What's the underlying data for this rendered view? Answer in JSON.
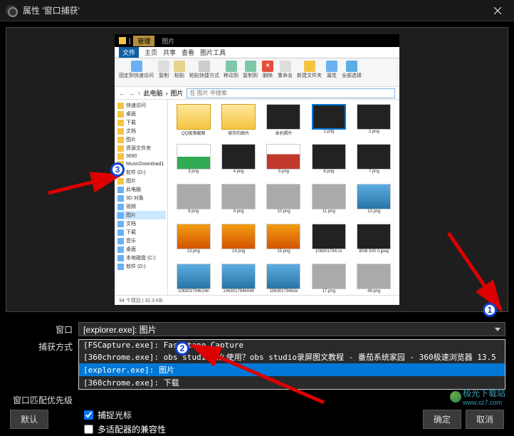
{
  "titlebar": {
    "title": "属性 '窗口捕获'"
  },
  "explorer": {
    "tab_main": "管理",
    "tab_sub": "图片",
    "ribbon": {
      "file": "文件",
      "home": "主页",
      "share": "共享",
      "view": "查看",
      "pictools": "图片工具"
    },
    "tools": {
      "nav": "固定到快速访问",
      "copy": "复制",
      "paste": "粘贴",
      "shortcut": "粘贴快捷方式",
      "move": "移动到",
      "copy_to": "复制到",
      "delete": "删除",
      "rename": "重命名",
      "new": "新建文件夹",
      "props": "属性",
      "select": "全部选择"
    },
    "path": {
      "seg1": "此电脑",
      "seg2": "图片",
      "search": "在 图片 中搜索"
    },
    "sidebar": [
      "快速访问",
      "桌面",
      "下载",
      "文档",
      "图片",
      "资源文件夹",
      "3690",
      "MusicDownload1",
      "软件 (D:)",
      "图片",
      "此电脑",
      "3D 对象",
      "视频",
      "图片",
      "文档",
      "下载",
      "音乐",
      "桌面",
      "本地磁盘 (C:)",
      "软件 (D:)"
    ],
    "thumbs": [
      {
        "cls": "folder",
        "name": "QQ极限截图"
      },
      {
        "cls": "folder",
        "name": "保存的图片"
      },
      {
        "cls": "dark",
        "name": "本机照片"
      },
      {
        "cls": "dark",
        "name": "1.png",
        "sel": true
      },
      {
        "cls": "dark",
        "name": "2.png"
      },
      {
        "cls": "mix",
        "name": "3.png"
      },
      {
        "cls": "dark",
        "name": "4.png"
      },
      {
        "cls": "red",
        "name": "5.png"
      },
      {
        "cls": "dark",
        "name": "6.png"
      },
      {
        "cls": "dark",
        "name": "7.png"
      },
      {
        "cls": "gray",
        "name": "8.png"
      },
      {
        "cls": "gray",
        "name": "9.png"
      },
      {
        "cls": "gray",
        "name": "10.png"
      },
      {
        "cls": "gray",
        "name": "11.png"
      },
      {
        "cls": "blue",
        "name": "12.png"
      },
      {
        "cls": "orange",
        "name": "13.png"
      },
      {
        "cls": "orange",
        "name": "14.png"
      },
      {
        "cls": "orange",
        "name": "15.png"
      },
      {
        "cls": "dark",
        "name": "106301794.sc"
      },
      {
        "cls": "dark",
        "name": "BSB 500 0.jpeg"
      },
      {
        "cls": "blue",
        "name": "106301794b14e"
      },
      {
        "cls": "blue",
        "name": "106301794b044"
      },
      {
        "cls": "blue",
        "name": "106301794b2e"
      },
      {
        "cls": "gray",
        "name": "17.png"
      },
      {
        "cls": "gray",
        "name": "48.png"
      }
    ],
    "status": "34 个项目  |  32.3 KB"
  },
  "form": {
    "window_label": "窗口",
    "window_value": "[explorer.exe]: 图片",
    "capture_label": "捕获方式",
    "priority_label": "窗口匹配优先级",
    "options": [
      "[FSCapture.exe]: FastStone Capture",
      "[360chrome.exe]: obs studio怎么使用？obs studio录屏图文教程 - 番茄系统家园 - 360极速浏览器 13.5",
      "[explorer.exe]: 图片",
      "[360chrome.exe]: 下载"
    ],
    "cursor_check": "捕捉光标",
    "compat_check": "多适配器的兼容性"
  },
  "buttons": {
    "defaults": "默认",
    "ok": "确定",
    "cancel": "取消"
  },
  "watermark": {
    "text": "极光下载站",
    "url": "www.xz7.com"
  },
  "badges": {
    "b1": "1",
    "b2": "2",
    "b3": "3"
  }
}
